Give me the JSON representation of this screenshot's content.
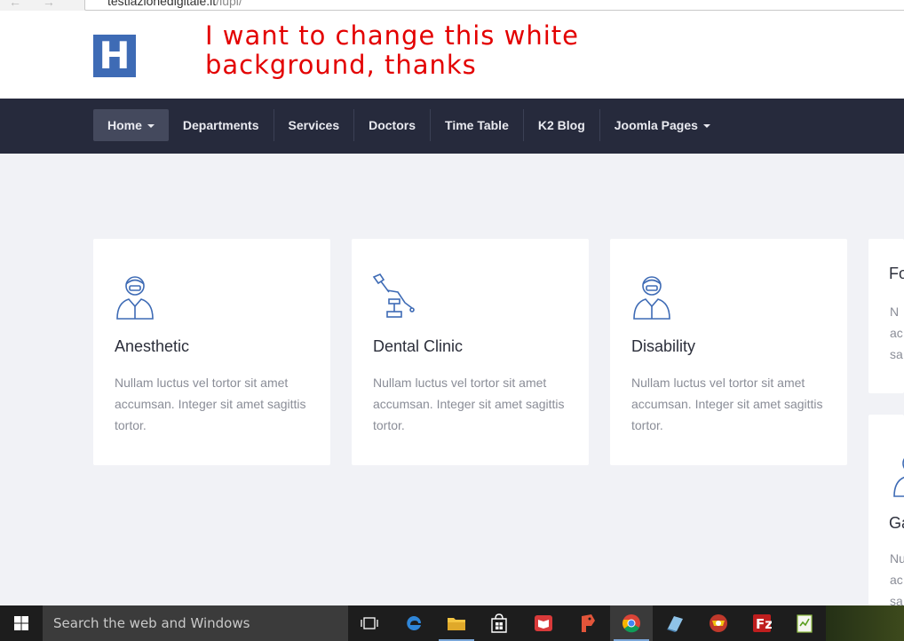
{
  "browser": {
    "url_host": "testiazionedigitale.it",
    "url_path": "/iupi/"
  },
  "header": {
    "logo_letter": "H",
    "annotation": "I want to change this white background, thanks"
  },
  "nav": {
    "items": [
      {
        "label": "Home",
        "active": true,
        "dropdown": true
      },
      {
        "label": "Departments"
      },
      {
        "label": "Services"
      },
      {
        "label": "Doctors"
      },
      {
        "label": "Time Table"
      },
      {
        "label": "K2 Blog"
      },
      {
        "label": "Joomla Pages",
        "dropdown": true
      }
    ]
  },
  "cards": [
    {
      "icon": "doctor-icon",
      "title": "Anesthetic",
      "text": "Nullam luctus vel tortor sit amet accumsan. Integer sit amet sagittis tortor."
    },
    {
      "icon": "dental-chair-icon",
      "title": "Dental Clinic",
      "text": "Nullam luctus vel tortor sit amet accumsan. Integer sit amet sagittis tortor."
    },
    {
      "icon": "doctor-icon",
      "title": "Disability",
      "text": "Nullam luctus vel tortor sit amet accumsan. Integer sit amet sagittis tortor."
    },
    {
      "title": "Fo",
      "text": "N ac sa"
    },
    {
      "icon": "doctor-icon",
      "title": "Ga",
      "text": "Nu ac sa"
    }
  ],
  "taskbar": {
    "search_placeholder": "Search the web and Windows",
    "apps": [
      "task-view-icon",
      "edge-icon",
      "file-explorer-icon",
      "store-icon",
      "reader-icon",
      "app-icon",
      "chrome-icon",
      "notepad-icon",
      "game-icon",
      "filezilla-icon",
      "notepadplusplus-icon"
    ],
    "active_app": "chrome-icon"
  },
  "colors": {
    "accent": "#3e6bb5",
    "navbar": "#262a3c",
    "nav_active": "#44495d",
    "annotation": "#e30000",
    "page_bg": "#f1f2f6"
  }
}
